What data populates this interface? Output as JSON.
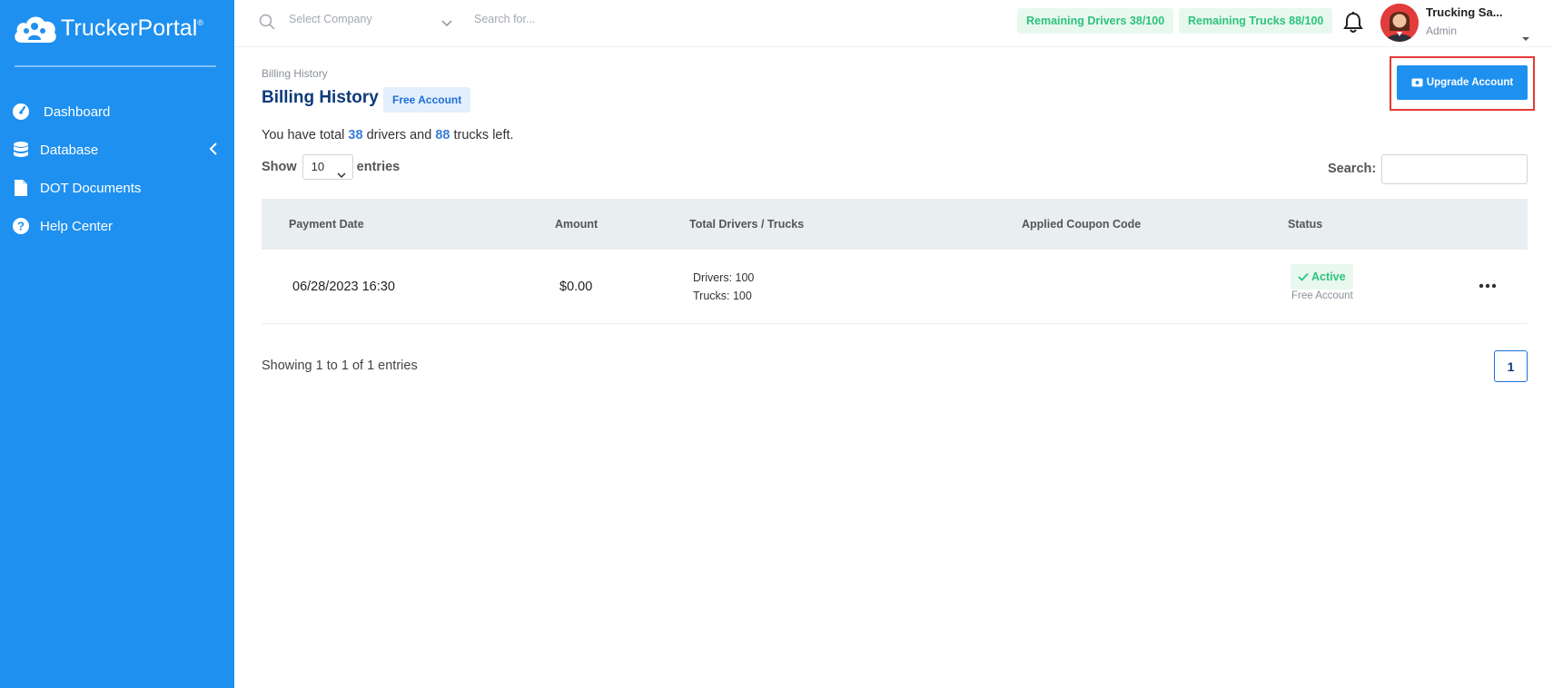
{
  "brand": {
    "name": "TruckerPortal",
    "mark": "®"
  },
  "sidebar": {
    "items": [
      {
        "label": "Dashboard",
        "icon": "dashboard-icon"
      },
      {
        "label": "Database",
        "icon": "database-icon"
      },
      {
        "label": "DOT Documents",
        "icon": "document-icon"
      },
      {
        "label": "Help Center",
        "icon": "help-icon"
      }
    ]
  },
  "topbar": {
    "company_placeholder": "Select Company",
    "search_placeholder": "Search for...",
    "remaining_drivers": "Remaining Drivers 38/100",
    "remaining_trucks": "Remaining Trucks 88/100",
    "user_name": "Trucking Sa...",
    "user_role": "Admin"
  },
  "page": {
    "breadcrumb": "Billing History",
    "title": "Billing History",
    "account_badge": "Free Account",
    "upgrade_label": "Upgrade Account",
    "summary": {
      "prefix": "You have total ",
      "drivers": "38",
      "middle": " drivers and ",
      "trucks": "88",
      "suffix": " trucks left."
    },
    "show_label": "Show",
    "entries_value": "10",
    "entries_label": "entries",
    "search_label": "Search:"
  },
  "table": {
    "headers": [
      "Payment Date",
      "Amount",
      "Total Drivers / Trucks",
      "Applied Coupon Code",
      "Status"
    ],
    "rows": [
      {
        "date": "06/28/2023 16:30",
        "amount": "$0.00",
        "drivers": "Drivers: 100",
        "trucks": "Trucks: 100",
        "coupon": "",
        "status": "Active",
        "status_sub": "Free Account"
      }
    ]
  },
  "footer": {
    "info": "Showing 1 to 1 of 1 entries",
    "page": "1"
  },
  "colors": {
    "sidebar": "#1e90f0",
    "title": "#0d3b7a",
    "success": "#2ec27e",
    "highlight": "#e53935"
  }
}
